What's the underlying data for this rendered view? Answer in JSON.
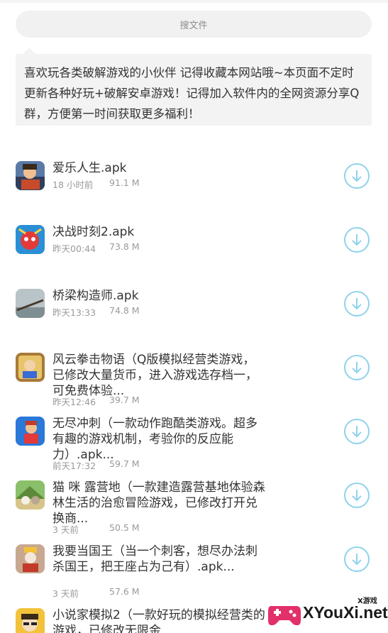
{
  "search": {
    "placeholder": "搜文件"
  },
  "notice": {
    "text": "喜欢玩各类破解游戏的小伙伴 记得收藏本网站哦~本页面不定时更新各种好玩+破解安卓游戏！记得加入软件内的全网资源分享Q群，方便第一时间获取更多福利！"
  },
  "files": [
    {
      "name": "爱乐人生.apk",
      "time": "18 小时前",
      "size": "91.1 M"
    },
    {
      "name": "决战时刻2.apk",
      "time": "昨天00:44",
      "size": "73.8 M"
    },
    {
      "name": "桥梁构造师.apk",
      "time": "昨天13:33",
      "size": "74.8 M"
    },
    {
      "name": "风云拳击物语（Q版模拟经营类游戏，已修改大量货币，进入游戏选存档一，可免费体验...",
      "time": "昨天12:46",
      "size": "39.7 M"
    },
    {
      "name": "无尽冲刺（一款动作跑酷类游戏。超多有趣的游戏机制，考验你的反应能力）.apk...",
      "time": "前天17:32",
      "size": "59.7 M"
    },
    {
      "name": "猫 咪 露营地（一款建造露营基地体验森林生活的治愈冒险游戏，已修改打开兑换商...",
      "time": "3 天前",
      "size": "50.5 M"
    },
    {
      "name": "我要当国王（当一个刺客，想尽办法刺杀国王，把王座占为己有）.apk...",
      "time": "3 天前",
      "size": "57.6 M"
    },
    {
      "name": "小说家模拟2（一款好玩的模拟经营类的游戏，已修改无限金",
      "time": "",
      "size": ""
    }
  ],
  "watermark": {
    "site": "XYouXi.net",
    "small": "X游戏"
  },
  "colors": {
    "accent": "#8fd2ec",
    "meta": "#9a9a9a",
    "text": "#333333"
  }
}
